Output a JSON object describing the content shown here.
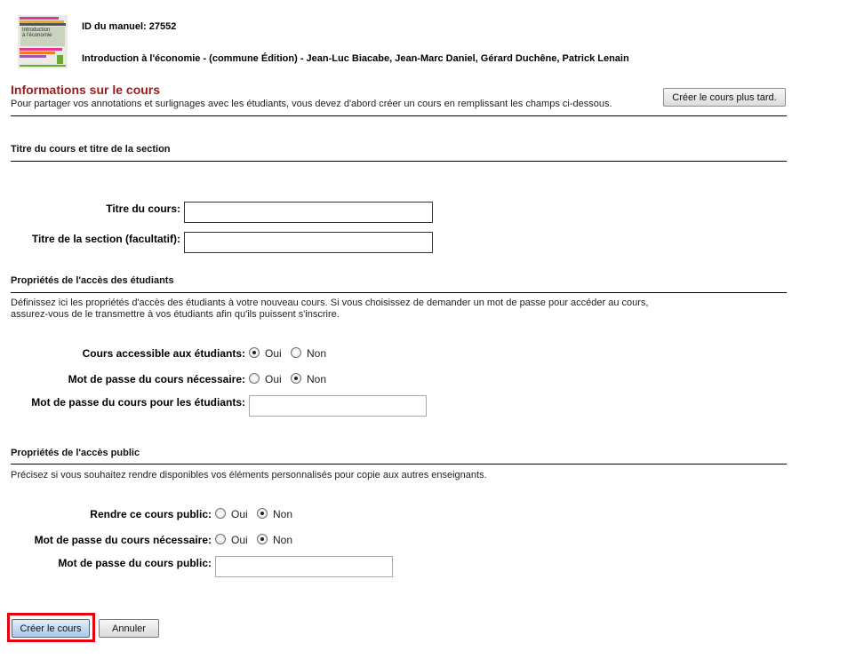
{
  "header": {
    "book_id_label": "ID du manuel: 27552",
    "book_title": "Introduction à l'économie - (commune Édition) - Jean-Luc Biacabe, Jean-Marc Daniel, Gérard Duchêne, Patrick  Lenain",
    "cover_text_line1": "Introduction",
    "cover_text_line2": "à l'économie"
  },
  "course_info": {
    "title": "Informations sur le cours",
    "intro": "Pour partager vos annotations et surlignages avec les étudiants, vous devez d'abord créer un  cours en remplissant les champs ci-dessous.",
    "create_later_button": "Créer le cours plus tard."
  },
  "titles_section": {
    "heading": "Titre du cours et titre de la section",
    "course_title_label": "Titre du cours:",
    "course_title_value": "",
    "section_title_label": "Titre de la section (facultatif):",
    "section_title_value": ""
  },
  "student_access": {
    "heading": "Propriétés de l'accès des étudiants",
    "description_line1": "Définissez ici les propriétés d'accès des étudiants à votre nouveau cours. Si vous choisissez de demander un mot de passe pour accéder au cours,",
    "description_line2": "assurez-vous de le transmettre à vos étudiants afin qu'ils puissent s'inscrire.",
    "accessible_label": "Cours accessible aux étudiants:",
    "accessible_value": "Oui",
    "password_required_label": "Mot de passe du cours nécessaire:",
    "password_required_value": "Non",
    "password_label": "Mot de passe du cours pour les étudiants:",
    "password_value": ""
  },
  "public_access": {
    "heading": "Propriétés de l'accès public",
    "description": "Précisez si vous souhaitez rendre disponibles vos éléments personnalisés pour copie aux autres enseignants.",
    "make_public_label": "Rendre ce cours public:",
    "make_public_value": "Non",
    "password_required_label": "Mot de passe du cours nécessaire:",
    "password_required_value": "Non",
    "password_label": "Mot de passe du cours public:",
    "password_value": ""
  },
  "radio_options": {
    "yes": "Oui",
    "no": "Non"
  },
  "actions": {
    "create_button": "Créer le cours",
    "cancel_button": "Annuler"
  },
  "colors": {
    "section_title": "#9b1b1b",
    "highlight_border": "#e8000b"
  }
}
